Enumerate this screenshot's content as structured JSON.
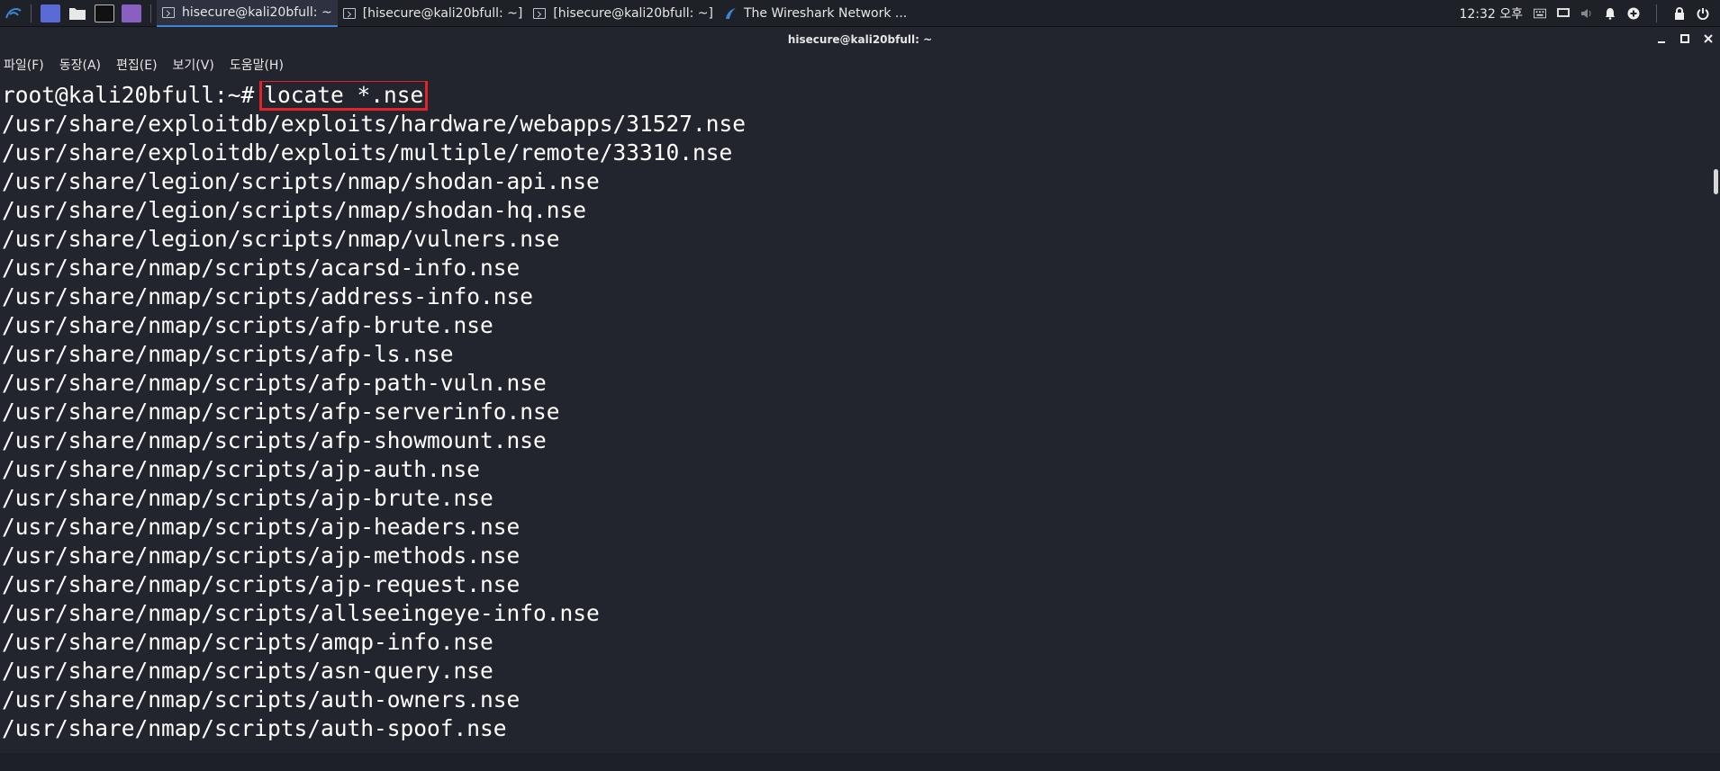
{
  "taskbar": {
    "tasks": [
      {
        "label": "hisecure@kali20bfull: ~",
        "active": true
      },
      {
        "label": "[hisecure@kali20bfull: ~]",
        "active": false
      },
      {
        "label": "[hisecure@kali20bfull: ~]",
        "active": false
      },
      {
        "label": "The Wireshark Network ...",
        "active": false
      }
    ],
    "clock": "12:32 오후"
  },
  "window": {
    "title": "hisecure@kali20bfull: ~"
  },
  "menu": [
    "파일(F)",
    "동장(A)",
    "편집(E)",
    "보기(V)",
    "도움말(H)"
  ],
  "terminal": {
    "prompt": "root@kali20bfull:~#",
    "command": "locate *.nse",
    "output": [
      "/usr/share/exploitdb/exploits/hardware/webapps/31527.nse",
      "/usr/share/exploitdb/exploits/multiple/remote/33310.nse",
      "/usr/share/legion/scripts/nmap/shodan-api.nse",
      "/usr/share/legion/scripts/nmap/shodan-hq.nse",
      "/usr/share/legion/scripts/nmap/vulners.nse",
      "/usr/share/nmap/scripts/acarsd-info.nse",
      "/usr/share/nmap/scripts/address-info.nse",
      "/usr/share/nmap/scripts/afp-brute.nse",
      "/usr/share/nmap/scripts/afp-ls.nse",
      "/usr/share/nmap/scripts/afp-path-vuln.nse",
      "/usr/share/nmap/scripts/afp-serverinfo.nse",
      "/usr/share/nmap/scripts/afp-showmount.nse",
      "/usr/share/nmap/scripts/ajp-auth.nse",
      "/usr/share/nmap/scripts/ajp-brute.nse",
      "/usr/share/nmap/scripts/ajp-headers.nse",
      "/usr/share/nmap/scripts/ajp-methods.nse",
      "/usr/share/nmap/scripts/ajp-request.nse",
      "/usr/share/nmap/scripts/allseeingeye-info.nse",
      "/usr/share/nmap/scripts/amqp-info.nse",
      "/usr/share/nmap/scripts/asn-query.nse",
      "/usr/share/nmap/scripts/auth-owners.nse",
      "/usr/share/nmap/scripts/auth-spoof.nse"
    ]
  },
  "colors": {
    "background": "#23252e",
    "text": "#ffffff",
    "highlight_box": "#e0242a"
  }
}
